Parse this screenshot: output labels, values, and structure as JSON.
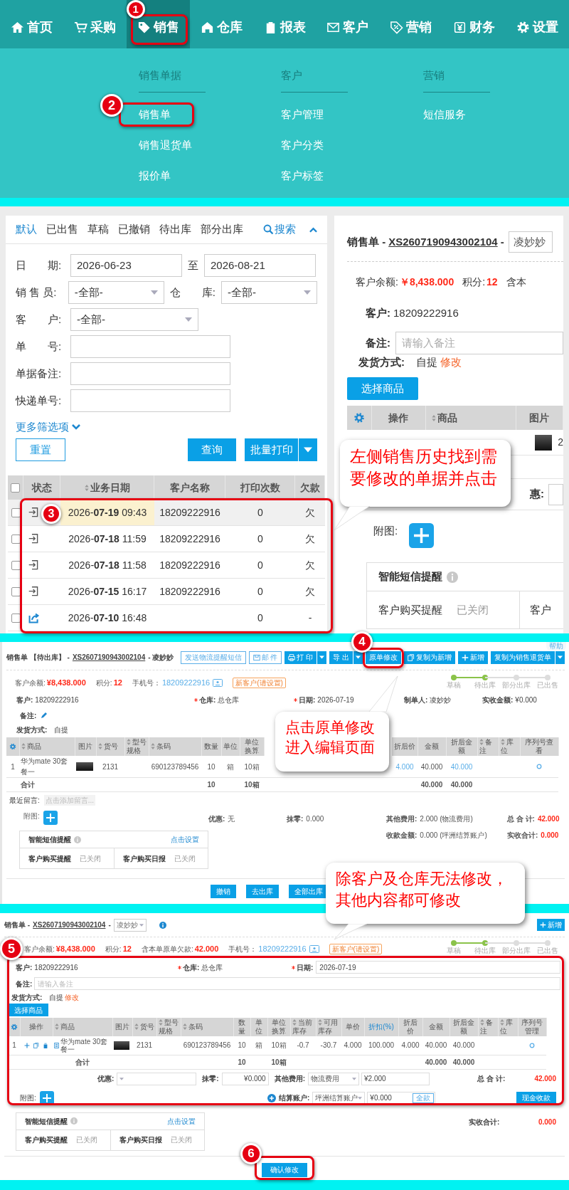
{
  "nav": {
    "items": [
      {
        "label": "首页",
        "kind": "home",
        "selected": false
      },
      {
        "label": "采购",
        "kind": "cart",
        "selected": false
      },
      {
        "label": "销售",
        "kind": "tag",
        "selected": true
      },
      {
        "label": "仓库",
        "kind": "house",
        "selected": false
      },
      {
        "label": "报表",
        "kind": "clipboard",
        "selected": false
      },
      {
        "label": "客户",
        "kind": "mail",
        "selected": false
      },
      {
        "label": "营销",
        "kind": "coupon",
        "selected": false
      },
      {
        "label": "财务",
        "kind": "yen",
        "selected": false
      },
      {
        "label": "设置",
        "kind": "gear",
        "selected": false
      }
    ]
  },
  "menu": {
    "columns": [
      {
        "heading": "销售单据",
        "items": [
          "销售单",
          "销售退货单",
          "报价单"
        ]
      },
      {
        "heading": "客户",
        "items": [
          "客户管理",
          "客户分类",
          "客户标签"
        ]
      },
      {
        "heading": "营销",
        "items": [
          "短信服务"
        ]
      }
    ]
  },
  "steps": [
    "1",
    "2",
    "3",
    "4",
    "5",
    "6"
  ],
  "callouts": [
    "左侧销售历史找到需要修改的单据并点击",
    "点击原单修改进入编辑页面",
    "除客户及仓库无法修改，其他内容都可修改"
  ],
  "history": {
    "tabs": [
      {
        "label": "默认",
        "selected": true
      },
      {
        "label": "已出售",
        "selected": false
      },
      {
        "label": "草稿",
        "selected": false
      },
      {
        "label": "已撤销",
        "selected": false
      },
      {
        "label": "待出库",
        "selected": false
      },
      {
        "label": "部分出库",
        "selected": false
      }
    ],
    "search": "搜索",
    "filters": [
      {
        "fields": [
          {
            "label": "日　　期:",
            "kind": "date",
            "value": "2026-06-23"
          },
          {
            "label": "至",
            "kind": "date",
            "value": "2026-08-21"
          }
        ]
      },
      {
        "fields": [
          {
            "label": "销 售 员:",
            "kind": "select",
            "value": "-全部-"
          },
          {
            "label": "仓　　库:",
            "kind": "select",
            "value": "-全部-"
          }
        ]
      },
      {
        "fields": [
          {
            "label": "客　　户:",
            "kind": "select",
            "value": "-全部-"
          }
        ]
      },
      {
        "fields": [
          {
            "label": "单　　号:",
            "kind": "text"
          }
        ]
      },
      {
        "fields": [
          {
            "label": "单据备注:",
            "kind": "text"
          }
        ]
      },
      {
        "fields": [
          {
            "label": "快递单号:",
            "kind": "text"
          }
        ]
      }
    ],
    "more_filters": "更多筛选项",
    "reset": "重置",
    "query": "查询",
    "print": "批量打印",
    "table": {
      "select_all": false,
      "columns": [
        {
          "label": "状态",
          "sortable": false
        },
        {
          "label": "业务日期",
          "sortable": true
        },
        {
          "label": "客户名称",
          "sortable": false
        },
        {
          "label": "打印次数",
          "sortable": false
        },
        {
          "label": "欠款",
          "sortable": false
        }
      ],
      "rows": [
        {
          "checked": false,
          "selected": true,
          "kind": "in",
          "date": "2026-**07-19** 09:43",
          "customer": "18209222916",
          "prints": "0",
          "debt": "欠"
        },
        {
          "checked": false,
          "selected": false,
          "kind": "in",
          "date": "2026-**07-18** 11:59",
          "customer": "18209222916",
          "prints": "0",
          "debt": "欠"
        },
        {
          "checked": false,
          "selected": false,
          "kind": "in",
          "date": "2026-**07-18** 11:58",
          "customer": "18209222916",
          "prints": "0",
          "debt": "欠"
        },
        {
          "checked": false,
          "selected": false,
          "kind": "in",
          "date": "2026-**07-15** 16:17",
          "customer": "18209222916",
          "prints": "0",
          "debt": "欠"
        },
        {
          "checked": false,
          "selected": false,
          "kind": "out",
          "date": "2026-**07-10** 16:48",
          "prints": "0",
          "debt": "-"
        }
      ]
    }
  },
  "order": {
    "title": "销售单 -",
    "number": "XS2607190943002104",
    "separator": "-",
    "salesperson": "凌妙妙",
    "balance_label": "客户余额:",
    "balance": "￥8,438.000",
    "points_label": "积分:",
    "points": "12",
    "cut_label": "含本",
    "customer_label": "客户:",
    "customer": "18209222916",
    "note_label": "备注:",
    "note_placeholder": "请输入备注",
    "shipping_label": "发货方式:",
    "shipping": "自提",
    "shipping_edit": "修改",
    "choose_button": "选择商品",
    "columns": [
      {
        "label": "操作",
        "sortable": false
      },
      {
        "label": "商品",
        "sortable": true
      },
      {
        "label": "图片",
        "sortable": false
      }
    ],
    "row_cut": "2",
    "discount_label": "惠:",
    "attach_label": "附图:",
    "sms": {
      "title": "智能短信提醒",
      "items": [
        {
          "label": "客户购买提醒",
          "value": "已关闭"
        }
      ],
      "cut_label": "客户"
    }
  },
  "view": {
    "title": "销售单 【待出库】 -",
    "number": "XS2607190943002104",
    "suffix": "- 凌妙妙",
    "help": "帮助",
    "buttons": [
      {
        "label": "发送物流提醒短信",
        "kind": "sms"
      },
      {
        "label": "邮 件",
        "kind": "mail"
      },
      {
        "label": "打 印",
        "kind": "print"
      },
      {
        "label": "导 出",
        "kind": "export"
      },
      {
        "label": "原单修改",
        "kind": "edit"
      },
      {
        "label": "复制为新增",
        "kind": "copy"
      },
      {
        "label": "新增",
        "kind": "add"
      },
      {
        "label": "复制为销售退货单",
        "kind": "return"
      }
    ],
    "info": [
      {
        "label": "客户余额:",
        "value": "¥8,438.000",
        "kind": "red"
      },
      {
        "label": "积分:",
        "value": "12",
        "kind": "red"
      },
      {
        "label": "手机号：",
        "value": "18209222916",
        "kind": "phone"
      }
    ],
    "tag": "新客户(请设置)",
    "progress": [
      {
        "label": "草稿",
        "done": true
      },
      {
        "label": "待出库",
        "done": true
      },
      {
        "label": "部分出库",
        "done": false
      },
      {
        "label": "已出售",
        "done": false
      }
    ],
    "fields": [
      {
        "label": "客户:",
        "value": "18209222916",
        "required": false
      },
      {
        "label": "仓库:",
        "value": "总仓库",
        "required": true
      },
      {
        "label": "日期:",
        "value": "2026-07-19",
        "required": true
      },
      {
        "label": "制单人:",
        "value": "凌妙妙",
        "required": false
      },
      {
        "label": "实收金额:",
        "value": "¥0.000",
        "required": false
      }
    ],
    "note_label": "备注:",
    "shipping_label": "发货方式:",
    "shipping": "自提",
    "row_index": "1",
    "columns": [
      {
        "label": "商品",
        "sortable": true,
        "kind": "text",
        "cell": "华为mate 30套餐一",
        "total": "合计"
      },
      {
        "label": "图片",
        "sortable": false,
        "kind": "image"
      },
      {
        "label": "货号",
        "sortable": true,
        "kind": "text",
        "cell": "2131"
      },
      {
        "label": "型号规格",
        "sortable": true,
        "kind": "text"
      },
      {
        "label": "条码",
        "sortable": true,
        "kind": "text",
        "cell": "690123789456"
      },
      {
        "label": "数量",
        "sortable": false,
        "kind": "text",
        "cell": "10",
        "total": "10"
      },
      {
        "label": "单位",
        "sortable": false,
        "kind": "text",
        "cell": "箱"
      },
      {
        "label": "单位换算",
        "sortable": false,
        "kind": "text",
        "cell": "10箱",
        "total": "10箱"
      },
      {
        "label": "折后价",
        "sortable": false,
        "kind": "link",
        "cell": "4.000"
      },
      {
        "label": "金额",
        "sortable": false,
        "kind": "text",
        "cell": "40.000",
        "total": "40.000"
      },
      {
        "label": "折后金额",
        "sortable": false,
        "kind": "link",
        "cell": "40.000",
        "total": "40.000"
      },
      {
        "label": "备注",
        "sortable": true,
        "kind": "text"
      },
      {
        "label": "库位",
        "sortable": true,
        "kind": "text"
      },
      {
        "label": "序列号查看",
        "sortable": false,
        "kind": "icon"
      }
    ],
    "message_label": "最近留言:",
    "message_placeholder": "点击添加留言...",
    "attach_label": "附图:",
    "summary": [
      [
        {
          "label": "优惠:",
          "value": "无",
          "kind": "plain"
        },
        {
          "label": "抹零:",
          "value": "0.000",
          "kind": "plain"
        },
        {
          "label": "其他费用:",
          "value": "2.000 (物流费用)",
          "kind": "plain"
        },
        {
          "label": "总 合 计:",
          "value": "42.000",
          "kind": "total"
        }
      ],
      [
        {
          "label": "收款金额:",
          "value": "0.000 (坪洲结算账户)",
          "kind": "plain"
        },
        {
          "label": "实收合计:",
          "value": "0.000",
          "kind": "total"
        }
      ]
    ],
    "sms": {
      "title": "智能短信提醒",
      "link": "点击设置",
      "items": [
        {
          "label": "客户购买提醒",
          "value": "已关闭"
        },
        {
          "label": "客户购买日报",
          "value": "已关闭"
        }
      ]
    },
    "actions": [
      "撤销",
      "去出库",
      "全部出库"
    ]
  },
  "edit": {
    "title": "销售单 -",
    "number": "XS2607190943002104",
    "separator": "-",
    "salesperson": "凌妙妙",
    "new_button": "新增",
    "info": [
      {
        "label": "客户余额:",
        "value": "¥8,438.000",
        "kind": "red"
      },
      {
        "label": "积分:",
        "value": "12",
        "kind": "red"
      },
      {
        "label": "含本单原单欠款:",
        "value": "42.000",
        "kind": "red"
      },
      {
        "label": "手机号：",
        "value": "18209222916",
        "kind": "phone"
      }
    ],
    "tag": "新客户(请设置)",
    "progress": [
      {
        "label": "草稿",
        "done": true
      },
      {
        "label": "待出库",
        "done": true
      },
      {
        "label": "部分出库",
        "done": false
      },
      {
        "label": "已出售",
        "done": false
      }
    ],
    "fields": [
      {
        "label": "客户:",
        "value": "18209222916",
        "required": false
      },
      {
        "label": "仓库:",
        "value": "总仓库",
        "required": true
      },
      {
        "label": "日期:",
        "value": "2026-07-19",
        "required": true
      }
    ],
    "note_label": "备注:",
    "note_placeholder": "请输入备注",
    "shipping_label": "发货方式:",
    "shipping": "自提",
    "shipping_edit": "修改",
    "choose_button": "选择商品",
    "row_index": "1",
    "columns": [
      {
        "label": "操作",
        "sortable": false,
        "kind": "ops"
      },
      {
        "label": "商品",
        "sortable": true,
        "kind": "product",
        "cell": "华为mate 30套餐一",
        "total": "合计"
      },
      {
        "label": "图片",
        "sortable": false,
        "kind": "image"
      },
      {
        "label": "货号",
        "sortable": true,
        "kind": "text",
        "cell": "2131"
      },
      {
        "label": "型号规格",
        "sortable": true,
        "kind": "text"
      },
      {
        "label": "条码",
        "sortable": true,
        "kind": "text",
        "cell": "690123789456"
      },
      {
        "label": "数量",
        "sortable": false,
        "kind": "text",
        "cell": "10",
        "total": "10"
      },
      {
        "label": "单位",
        "sortable": false,
        "kind": "text",
        "cell": "箱"
      },
      {
        "label": "单位换算",
        "sortable": false,
        "kind": "text",
        "cell": "10箱",
        "total": "10箱"
      },
      {
        "label": "当前库存",
        "sortable": true,
        "kind": "text",
        "cell": "-0.7"
      },
      {
        "label": "可用库存",
        "sortable": true,
        "kind": "text",
        "cell": "-30.7"
      },
      {
        "label": "单价",
        "sortable": false,
        "kind": "text",
        "cell": "4.000"
      },
      {
        "label": "折扣(%)",
        "sortable": false,
        "kind": "link",
        "cell": "100.000"
      },
      {
        "label": "折后价",
        "sortable": false,
        "kind": "text",
        "cell": "4.000"
      },
      {
        "label": "金额",
        "sortable": false,
        "kind": "text",
        "cell": "40.000",
        "total": "40.000"
      },
      {
        "label": "折后金额",
        "sortable": false,
        "kind": "text",
        "cell": "40.000",
        "total": "40.000"
      },
      {
        "label": "备注",
        "sortable": true,
        "kind": "text"
      },
      {
        "label": "库位",
        "sortable": true,
        "kind": "text"
      },
      {
        "label": "序列号管理",
        "sortable": false,
        "kind": "icon"
      }
    ],
    "discount_label": "优惠:",
    "rounding_label": "抹零:",
    "rounding_value": "¥0.000",
    "other_fee_label": "其他费用:",
    "other_fee_type": "物流费用",
    "other_fee_value": "¥2.000",
    "total_label": "总 合 计:",
    "total": "42.000",
    "attach_label": "附图:",
    "account_label": "结算账户:",
    "account": "坪洲结算账户",
    "received_value": "¥0.000",
    "full_button": "全款",
    "cash_button": "现金收款",
    "received_total_label": "实收合计:",
    "received_total": "0.000",
    "sms": {
      "title": "智能短信提醒",
      "link": "点击设置",
      "items": [
        {
          "label": "客户购买提醒",
          "value": "已关闭"
        },
        {
          "label": "客户购买日报",
          "value": "已关闭"
        }
      ]
    },
    "confirm": "确认修改"
  }
}
